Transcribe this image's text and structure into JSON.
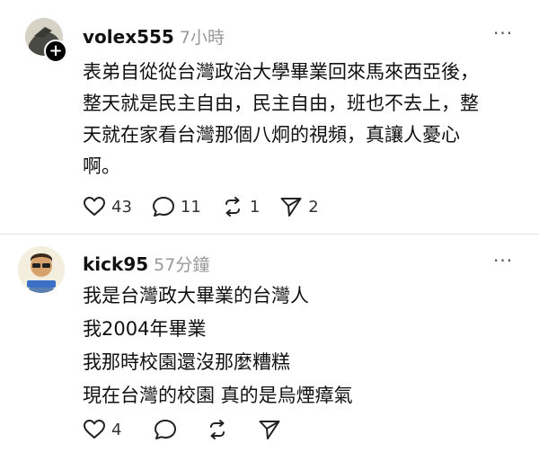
{
  "posts": [
    {
      "username": "volex555",
      "time": "7小時",
      "body_lines": [
        "表弟自從從台灣政治大學畢業回來馬來西亞後，",
        "整天就是民主自由，民主自由，班也不去上，整",
        "天就在家看台灣那個八炯的視頻，真讓人憂心",
        "啊。"
      ],
      "likes": "43",
      "comments": "11",
      "reposts": "1",
      "shares": "2",
      "more_label": "···"
    },
    {
      "username": "kick95",
      "time": "57分鐘",
      "body_lines": [
        "我是台灣政大畢業的台灣人",
        "我2004年畢業",
        "我那時校園還沒那麼糟糕",
        "現在台灣的校園 真的是烏煙瘴氣"
      ],
      "likes": "4",
      "more_label": "···"
    }
  ],
  "icons": {
    "like": "heart-icon",
    "comment": "comment-bubble-icon",
    "repost": "repost-icon",
    "share": "send-icon",
    "follow": "plus-icon"
  },
  "colors": {
    "text": "#111111",
    "muted": "#999999",
    "divider": "#e3e3e3"
  }
}
